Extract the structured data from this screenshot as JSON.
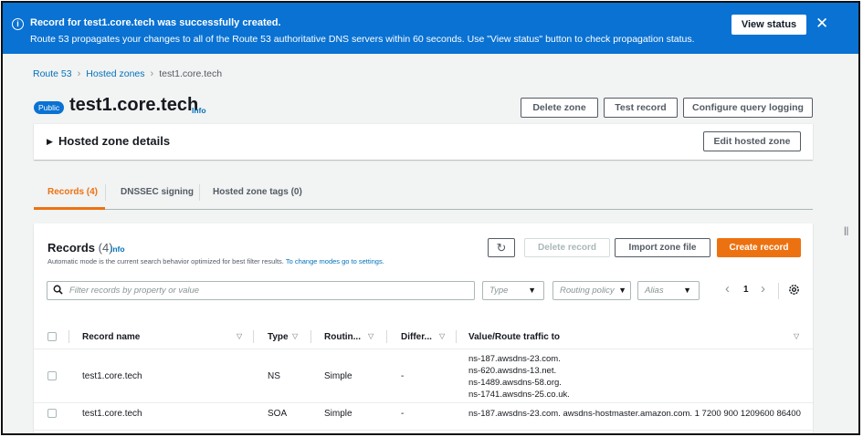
{
  "flash": {
    "title": "Record for test1.core.tech was successfully created.",
    "message": "Route 53 propagates your changes to all of the Route 53 authoritative DNS servers within 60 seconds. Use \"View status\" button to check propagation status.",
    "view_status_label": "View status",
    "close_glyph": "✕",
    "info_glyph": "i",
    "color": "#0972d3"
  },
  "breadcrumb": {
    "items": [
      "Route 53",
      "Hosted zones",
      "test1.core.tech"
    ],
    "sep": "›"
  },
  "header": {
    "badge": "Public",
    "title": "test1.core.tech",
    "info": "Info",
    "buttons": {
      "delete_zone": "Delete zone",
      "test_record": "Test record",
      "configure_logging": "Configure query logging"
    }
  },
  "zone_details": {
    "caret": "▶",
    "title": "Hosted zone details",
    "edit_label": "Edit hosted zone"
  },
  "tabs": [
    {
      "label": "Records (4)",
      "active": true
    },
    {
      "label": "DNSSEC signing",
      "active": false
    },
    {
      "label": "Hosted zone tags (0)",
      "active": false
    }
  ],
  "records": {
    "title": "Records",
    "count": "(4)",
    "info": "Info",
    "description": "Automatic mode is the current search behavior optimized for best filter results.",
    "description_link": "To change modes go to settings.",
    "refresh_glyph": "↻",
    "delete_label": "Delete record",
    "import_label": "Import zone file",
    "create_label": "Create record",
    "filter_placeholder": "Filter records by property or value",
    "dropdowns": {
      "type": "Type",
      "routing": "Routing policy",
      "alias": "Alias",
      "arrow": "▼"
    },
    "pager": {
      "prev": "‹",
      "page": "1",
      "next": "›"
    },
    "columns": {
      "name": "Record name",
      "type": "Type",
      "routing": "Routin...",
      "differ": "Differ...",
      "value": "Value/Route traffic to",
      "sort_glyph": "▽"
    },
    "rows": [
      {
        "name": "test1.core.tech",
        "type": "NS",
        "routing": "Simple",
        "differ": "-",
        "values": [
          "ns-187.awsdns-23.com.",
          "ns-620.awsdns-13.net.",
          "ns-1489.awsdns-58.org.",
          "ns-1741.awsdns-25.co.uk."
        ]
      },
      {
        "name": "test1.core.tech",
        "type": "SOA",
        "routing": "Simple",
        "differ": "-",
        "values": [
          "ns-187.awsdns-23.com. awsdns-hostmaster.amazon.com. 1 7200 900 1209600 86400"
        ]
      }
    ]
  },
  "side_handle": "||",
  "colors": {
    "accent_orange": "#ec7211",
    "link_blue": "#0073bb",
    "page_bg": "#f2f3f3"
  }
}
